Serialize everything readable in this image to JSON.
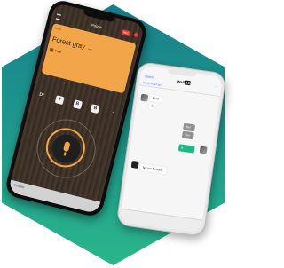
{
  "dark_app": {
    "title": "Poizoc",
    "rec_badge": "REC",
    "card": {
      "header_left": "Work",
      "header_right": "→",
      "title": "Forest gray →",
      "tag_label": "Free"
    },
    "tools": [
      "Dt",
      "T",
      "B",
      "B",
      "·"
    ],
    "bottom_label": "I'ml for"
  },
  "chat_app": {
    "back_label": "< Back",
    "logo_text": "Walk",
    "logo_badge": "HI",
    "more_label": "···",
    "subtitle": "Gosip for 16 go",
    "messages": [
      {
        "side": "left",
        "style": "white",
        "text": "Huet"
      },
      {
        "side": "left",
        "style": "white",
        "text": "8"
      },
      {
        "side": "right",
        "style": "gray",
        "text": "Bel"
      },
      {
        "side": "right",
        "style": "gray",
        "text": "Nor"
      },
      {
        "side": "right",
        "style": "green",
        "text": "8"
      },
      {
        "side": "left",
        "style": "white",
        "text": "Nassn Booser"
      }
    ]
  },
  "colors": {
    "hex_top": "#1a7f8a",
    "hex_bottom": "#2bb58b",
    "accent_orange": "#f2a649",
    "rec_red": "#e53935",
    "chat_green": "#1fb787"
  }
}
